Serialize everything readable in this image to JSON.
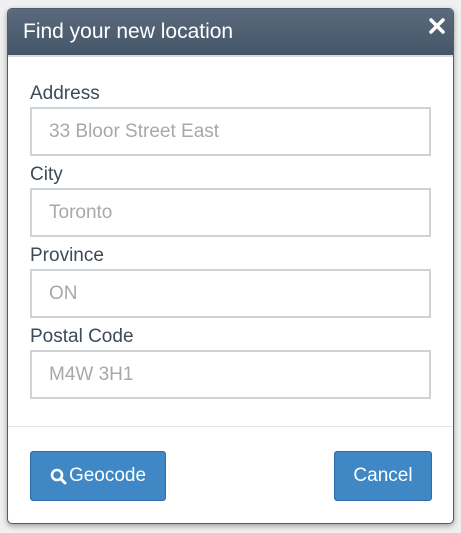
{
  "dialog": {
    "title": "Find your new location",
    "close_icon": "close-icon"
  },
  "form": {
    "fields": [
      {
        "label": "Address",
        "placeholder": "33 Bloor Street East"
      },
      {
        "label": "City",
        "placeholder": "Toronto"
      },
      {
        "label": "Province",
        "placeholder": "ON"
      },
      {
        "label": "Postal Code",
        "placeholder": "M4W 3H1"
      }
    ]
  },
  "footer": {
    "geocode_label": "Geocode",
    "geocode_icon": "search-icon",
    "cancel_label": "Cancel"
  },
  "colors": {
    "header": "#4e5d6c",
    "button": "#3f88c5"
  }
}
